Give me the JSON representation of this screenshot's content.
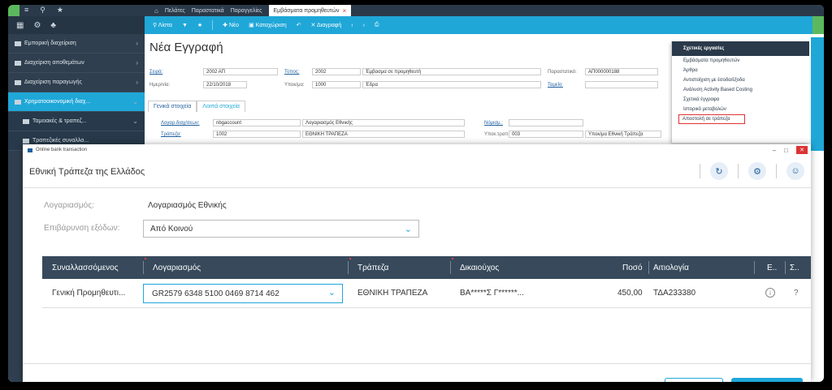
{
  "topbar": {
    "tabs": [
      "Πελάτες",
      "Παραστατικά",
      "Παραγγελίες"
    ],
    "active_tab": "Εμβάσματα προμηθευτών"
  },
  "sidebar": {
    "items": [
      {
        "label": "Εμπορική διαχείριση"
      },
      {
        "label": "Διαχείριση αποθεμάτων"
      },
      {
        "label": "Διαχείριση παραγωγής"
      },
      {
        "label": "Χρηματοοικονομική διαχ..."
      },
      {
        "label": "Ταμειακές & τραπεζ..."
      },
      {
        "label": "Τραπεζικές συναλλα..."
      }
    ]
  },
  "toolbar": {
    "items": [
      "Λίστα",
      "Νέο",
      "Καταχώριση",
      "Διαγραφή"
    ]
  },
  "form": {
    "title": "Νέα Εγγραφή",
    "fields": {
      "series_label": "Σειρά:",
      "series_value": "2002 ΑΠ",
      "type_label": "Τύπος:",
      "type_code": "2002",
      "type_value": "Έμβασμα σε προμηθευτή",
      "docno_label": "Παραστατικό:",
      "docno_value": "ΑΠ000000188",
      "date_label": "Ημερ/νία:",
      "date_value": "22/10/2018",
      "branch_label": "Υποκ/μα:",
      "branch_code": "1000",
      "branch_value": "Έδρα",
      "cashier_label": "Ταμείο:",
      "acct_label": "Λογαρ.διαχ/σεων:",
      "acct_code": "nbgaccount",
      "acct_value": "Λογαριασμός Εθνικής",
      "bank_label": "Τράπεζα:",
      "bank_code": "1002",
      "bank_value": "ΕΘΝΙΚΗ ΤΡΑΠΕΖΑ",
      "currency_label": "Νόμισμ.:",
      "branch2_label": "Υποκ.τραπ:",
      "branch2_code": "003",
      "branch2_value": "Υποκ/μα Εθνική Τράπεζα"
    },
    "subtabs": [
      "Γενικά στοιχεία",
      "Λοιπά στοιχεία"
    ]
  },
  "related_panel": {
    "header": "Σχετικές εργασίες",
    "items": [
      "Εμβάσματα προμηθευτών",
      "Άρθρα",
      "Αντιστοίχιση με έσοδα/έξοδα",
      "Ανάλυση Activity Based Costing",
      "Σχετικά έγγραφα",
      "Ιστορικό μεταβολών",
      "Αποστολή σε τράπεζα"
    ]
  },
  "modal": {
    "window_title": "Online bank transaction",
    "title": "Εθνική Τράπεζα της Ελλάδος",
    "account_label": "Λογαριασμός:",
    "account_value": "Λογαριασμός Εθνικής",
    "charge_label": "Επιβάρυνση εξόδων:",
    "charge_value": "Από Κοινού",
    "table": {
      "headers": [
        "Συναλλασσόμενος",
        "Λογαριασμός",
        "Τράπεζα",
        "Δικαιούχος",
        "Ποσό",
        "Αιτιολογία",
        "Ε..",
        "Σ.."
      ],
      "row": {
        "party": "Γενική Προμηθευτι...",
        "iban": "GR2579 6348 5100 0469 8714 462",
        "bank": "ΕΘΝΙΚΗ ΤΡΑΠΕΖΑ",
        "beneficiary": "ΒΑ*****Σ Γ******...",
        "amount": "450,00",
        "reason": "ΤΔΑ233380",
        "status_icon": "info-icon",
        "help": "?"
      }
    }
  }
}
